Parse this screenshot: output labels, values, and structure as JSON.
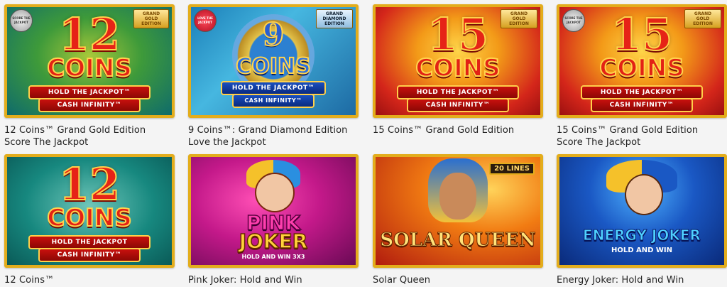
{
  "games": [
    {
      "caption": "12 Coins™ Grand Gold Edition Score The Jackpot",
      "number": "12",
      "word": "COINS",
      "ribbon1": "HOLD THE JACKPOT™",
      "ribbon2": "CASH INFINITY™",
      "badge": "GRAND GOLD EDITION",
      "badge_left": "SCORE THE JACKPOT"
    },
    {
      "caption": "9 Coins™: Grand Diamond Edition Love the Jackpot",
      "number": "9",
      "word": "COINS",
      "ribbon1": "HOLD THE JACKPOT™",
      "ribbon2": "CASH INFINITY™",
      "badge": "GRAND DIAMOND EDITION",
      "badge_left": "LOVE THE JACKPOT"
    },
    {
      "caption": "15 Coins™ Grand Gold Edition",
      "number": "15",
      "word": "COINS",
      "ribbon1": "HOLD THE JACKPOT™",
      "ribbon2": "CASH INFINITY™",
      "badge": "GRAND GOLD EDITION"
    },
    {
      "caption": "15 Coins™ Grand Gold Edition Score The Jackpot",
      "number": "15",
      "word": "COINS",
      "ribbon1": "HOLD THE JACKPOT™",
      "ribbon2": "CASH INFINITY™",
      "badge": "GRAND GOLD EDITION",
      "badge_left": "SCORE THE JACKPOT"
    },
    {
      "caption": "12 Coins™",
      "number": "12",
      "word": "COINS",
      "ribbon1": "HOLD THE JACKPOT",
      "ribbon2": "CASH INFINITY™"
    },
    {
      "caption": "Pink Joker: Hold and Win",
      "title1": "PINK",
      "title2": "JOKER",
      "sub": "HOLD AND WIN 3X3"
    },
    {
      "caption": "Solar Queen",
      "title1": "SOLAR QUEEN",
      "tag": "20 LINES"
    },
    {
      "caption": "Energy Joker: Hold and Win",
      "title1": "ENERGY JOKER",
      "sub": "HOLD AND WIN"
    }
  ]
}
